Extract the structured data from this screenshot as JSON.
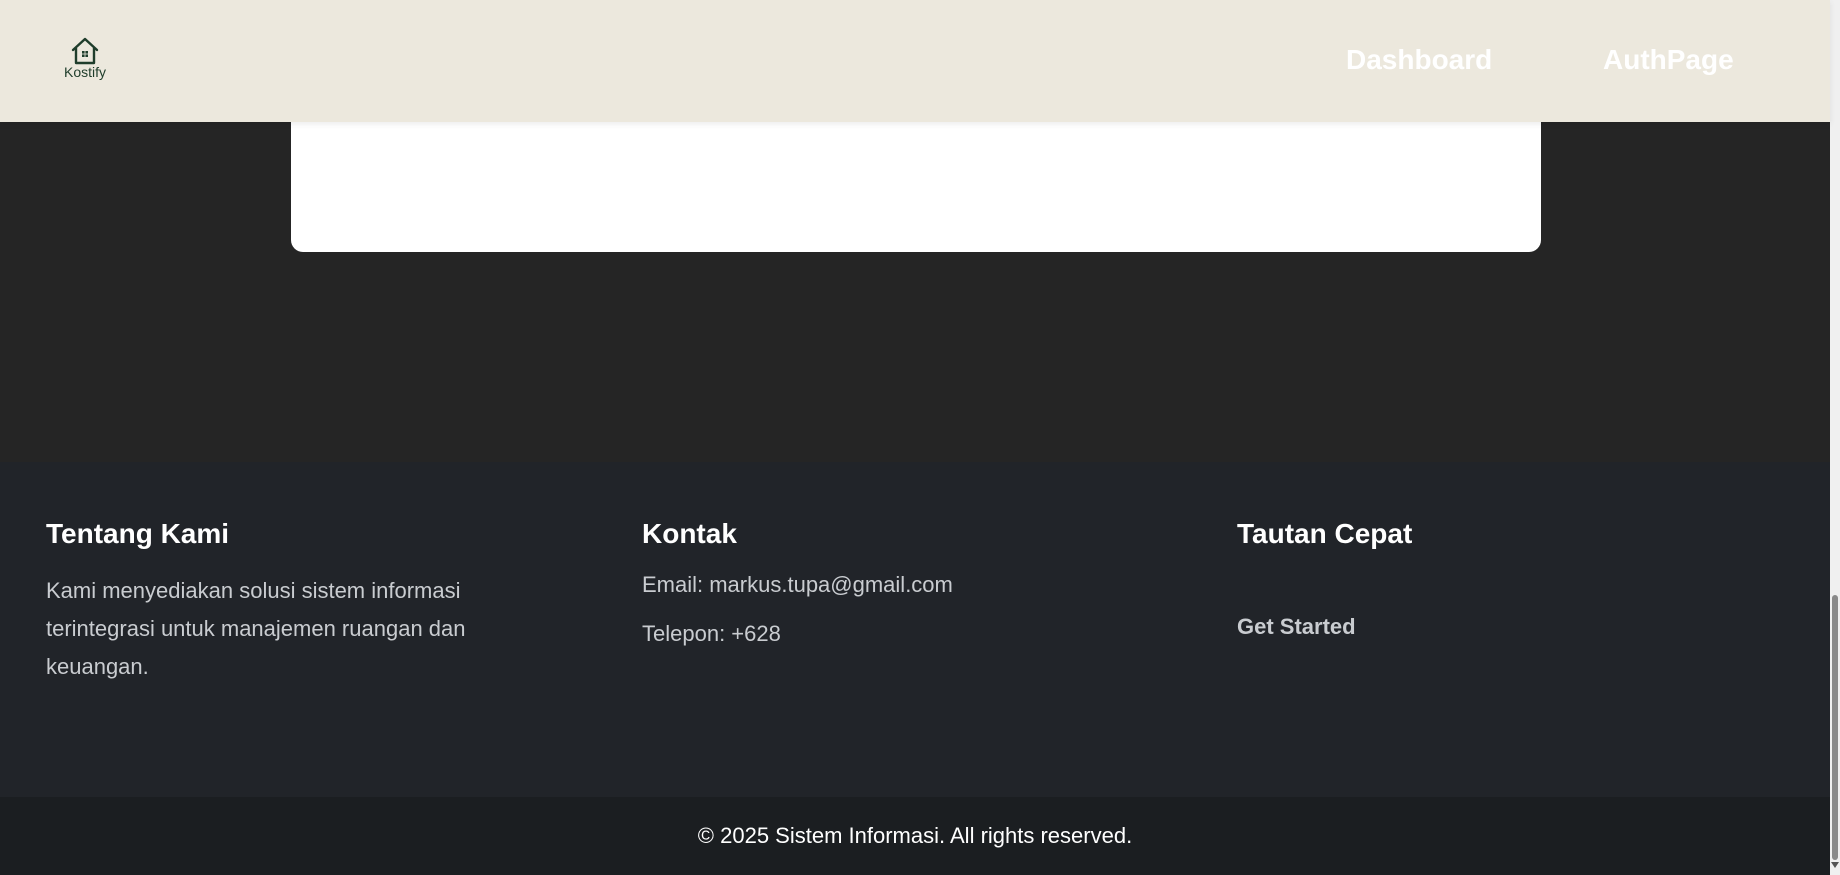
{
  "navbar": {
    "logo_text": "Kostify",
    "links": [
      {
        "label": "Dashboard"
      },
      {
        "label": "AuthPage"
      }
    ]
  },
  "footer": {
    "about": {
      "heading": "Tentang Kami",
      "text": "Kami menyediakan solusi sistem informasi terintegrasi untuk manajemen ruangan dan keuangan."
    },
    "contact": {
      "heading": "Kontak",
      "email": "Email: markus.tupa@gmail.com",
      "phone": "Telepon: +628"
    },
    "quick_links": {
      "heading": "Tautan Cepat",
      "items": [
        {
          "label": "Get Started"
        }
      ]
    },
    "copyright": "© 2025 Sistem Informasi. All rights reserved."
  },
  "colors": {
    "navbar_bg": "#ECE8DD",
    "page_bg": "#252525",
    "footer_bg": "#212429",
    "bottom_bar_bg": "#1b1e21",
    "brand": "#1f3d2b"
  },
  "icons": {
    "logo": "house-icon"
  }
}
